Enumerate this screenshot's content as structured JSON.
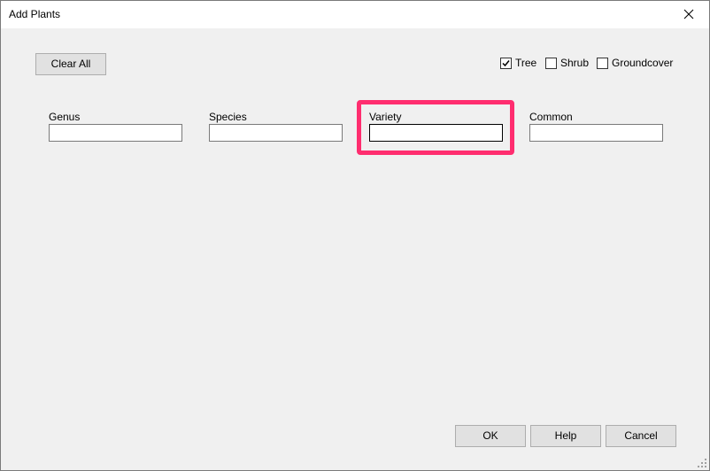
{
  "window": {
    "title": "Add Plants"
  },
  "toolbar": {
    "clear_all_label": "Clear All"
  },
  "filters": {
    "tree": {
      "label": "Tree",
      "checked": true
    },
    "shrub": {
      "label": "Shrub",
      "checked": false
    },
    "groundcover": {
      "label": "Groundcover",
      "checked": false
    }
  },
  "fields": {
    "genus": {
      "label": "Genus",
      "value": ""
    },
    "species": {
      "label": "Species",
      "value": ""
    },
    "variety": {
      "label": "Variety",
      "value": ""
    },
    "common": {
      "label": "Common",
      "value": ""
    }
  },
  "footer": {
    "ok_label": "OK",
    "help_label": "Help",
    "cancel_label": "Cancel"
  },
  "colors": {
    "highlight": "#ff2d6f",
    "dialog_bg": "#f0f0f0",
    "button_bg": "#e1e1e1"
  },
  "icons": {
    "close": "close-icon",
    "check": "checkmark-icon",
    "grip": "resize-grip-icon"
  }
}
